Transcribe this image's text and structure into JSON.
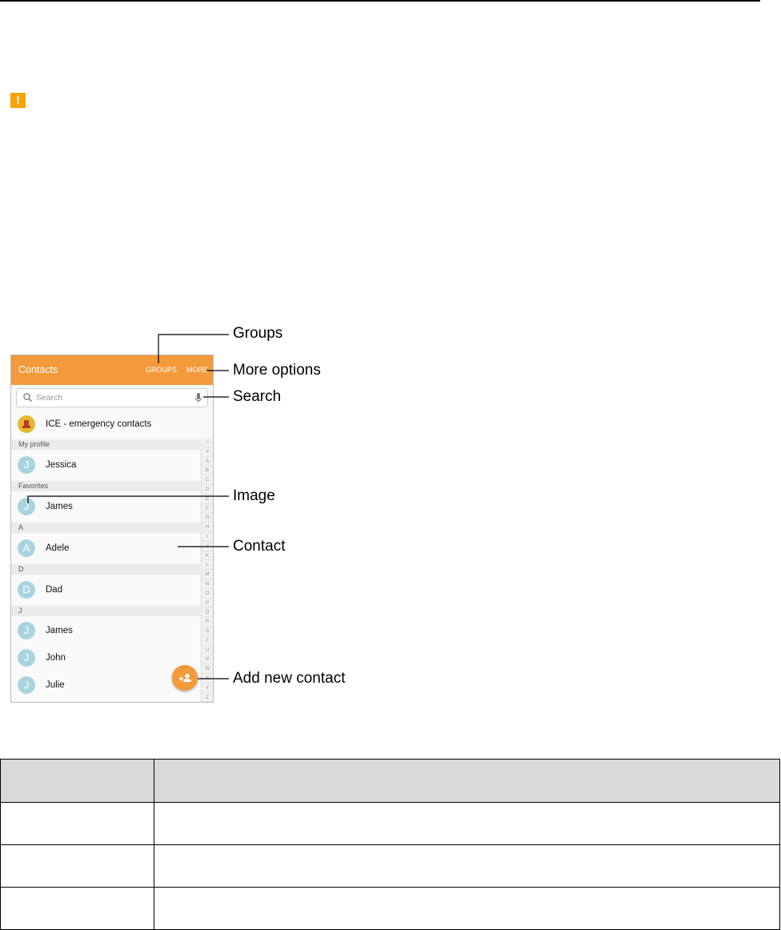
{
  "alert": {
    "icon": "warning-icon",
    "glyph": "!",
    "color": "#f5a300"
  },
  "app": {
    "title": "Contacts",
    "groups_label": "GROUPS",
    "more_label": "MORE",
    "bar_color": "#f39a3b",
    "search_placeholder": "Search",
    "ice_label": "ICE - emergency contacts",
    "sections": {
      "my_profile": "My profile",
      "favorites": "Favorites",
      "a": "A",
      "d": "D",
      "j": "J"
    },
    "contacts": {
      "profile": {
        "initial": "J",
        "name": "Jessica"
      },
      "favorite": {
        "initial": "J",
        "name": "James"
      },
      "adele": {
        "initial": "A",
        "name": "Adele"
      },
      "dad": {
        "initial": "D",
        "name": "Dad"
      },
      "james": {
        "initial": "J",
        "name": "James"
      },
      "john": {
        "initial": "J",
        "name": "John"
      },
      "julie": {
        "initial": "J",
        "name": "Julie"
      }
    },
    "index_letters": [
      "☆",
      "#",
      "A",
      "B",
      "C",
      "D",
      "E",
      "F",
      "G",
      "H",
      "I",
      "J",
      "K",
      "L",
      "M",
      "N",
      "O",
      "P",
      "Q",
      "R",
      "S",
      "T",
      "U",
      "V",
      "W",
      "X",
      "Y",
      "Z"
    ]
  },
  "callouts": {
    "groups": "Groups",
    "more_options": "More options",
    "search": "Search",
    "image": "Image",
    "contact": "Contact",
    "add_new_contact": "Add new contact"
  },
  "table": {
    "header": [
      "",
      ""
    ],
    "rows": [
      [
        "",
        ""
      ],
      [
        "",
        ""
      ],
      [
        "",
        ""
      ]
    ]
  }
}
